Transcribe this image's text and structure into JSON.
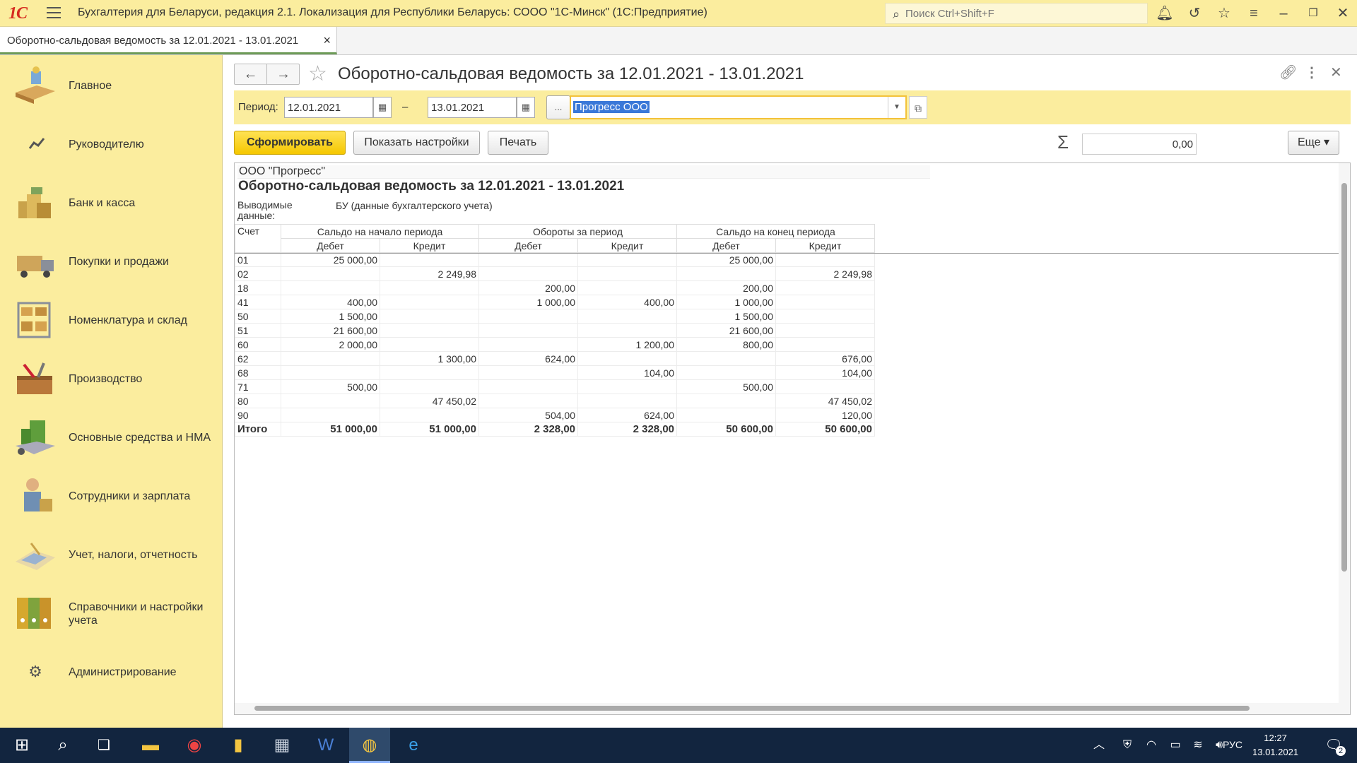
{
  "titlebar": {
    "logo": "1С",
    "app_title": "Бухгалтерия для Беларуси, редакция 2.1. Локализация для Республики Беларусь: СООО \"1С-Минск\"  (1С:Предприятие)",
    "search_placeholder": "Поиск Ctrl+Shift+F"
  },
  "tab": {
    "label": "Оборотно-сальдовая ведомость за 12.01.2021 - 13.01.2021",
    "close": "×"
  },
  "sidebar": {
    "items": [
      {
        "label": "Главное",
        "icon": "desk-icon"
      },
      {
        "label": "Руководителю",
        "icon": "trend-icon"
      },
      {
        "label": "Банк и касса",
        "icon": "coins-icon"
      },
      {
        "label": "Покупки и продажи",
        "icon": "truck-icon"
      },
      {
        "label": "Номенклатура и склад",
        "icon": "shelves-icon"
      },
      {
        "label": "Производство",
        "icon": "toolbox-icon"
      },
      {
        "label": "Основные средства и НМА",
        "icon": "building-icon"
      },
      {
        "label": "Сотрудники и зарплата",
        "icon": "worker-icon"
      },
      {
        "label": "Учет, налоги, отчетность",
        "icon": "calculator-icon"
      },
      {
        "label": "Справочники и настройки учета",
        "icon": "binders-icon"
      },
      {
        "label": "Администрирование",
        "icon": "gear-icon"
      }
    ]
  },
  "form": {
    "title": "Оборотно-сальдовая ведомость за 12.01.2021 - 13.01.2021",
    "period_label": "Период:",
    "date_from": "12.01.2021",
    "dash": "–",
    "date_to": "13.01.2021",
    "ellipsis": "...",
    "organization": "Прогресс ООО",
    "btn_generate": "Сформировать",
    "btn_settings": "Показать настройки",
    "btn_print": "Печать",
    "sum": "0,00",
    "btn_more": "Еще"
  },
  "report": {
    "org": "ООО \"Прогресс\"",
    "title": "Оборотно-сальдовая ведомость за 12.01.2021 - 13.01.2021",
    "output_label": "Выводимые данные:",
    "output_value": "БУ (данные бухгалтерского учета)",
    "col_account": "Счет",
    "groups": [
      "Сальдо на начало периода",
      "Обороты за период",
      "Сальдо на конец периода"
    ],
    "sub": [
      "Дебет",
      "Кредит",
      "Дебет",
      "Кредит",
      "Дебет",
      "Кредит"
    ],
    "rows": [
      [
        "01",
        "25 000,00",
        "",
        "",
        "",
        "25 000,00",
        ""
      ],
      [
        "02",
        "",
        "2 249,98",
        "",
        "",
        "",
        "2 249,98"
      ],
      [
        "18",
        "",
        "",
        "200,00",
        "",
        "200,00",
        ""
      ],
      [
        "41",
        "400,00",
        "",
        "1 000,00",
        "400,00",
        "1 000,00",
        ""
      ],
      [
        "50",
        "1 500,00",
        "",
        "",
        "",
        "1 500,00",
        ""
      ],
      [
        "51",
        "21 600,00",
        "",
        "",
        "",
        "21 600,00",
        ""
      ],
      [
        "60",
        "2 000,00",
        "",
        "",
        "1 200,00",
        "800,00",
        ""
      ],
      [
        "62",
        "",
        "1 300,00",
        "624,00",
        "",
        "",
        "676,00"
      ],
      [
        "68",
        "",
        "",
        "",
        "104,00",
        "",
        "104,00"
      ],
      [
        "71",
        "500,00",
        "",
        "",
        "",
        "500,00",
        ""
      ],
      [
        "80",
        "",
        "47 450,02",
        "",
        "",
        "",
        "47 450,02"
      ],
      [
        "90",
        "",
        "",
        "504,00",
        "624,00",
        "",
        "120,00"
      ]
    ],
    "total": [
      "Итого",
      "51 000,00",
      "51 000,00",
      "2 328,00",
      "2 328,00",
      "50 600,00",
      "50 600,00"
    ]
  },
  "taskbar": {
    "lang": "РУС",
    "time": "12:27",
    "date": "13.01.2021",
    "notif_count": "2"
  }
}
